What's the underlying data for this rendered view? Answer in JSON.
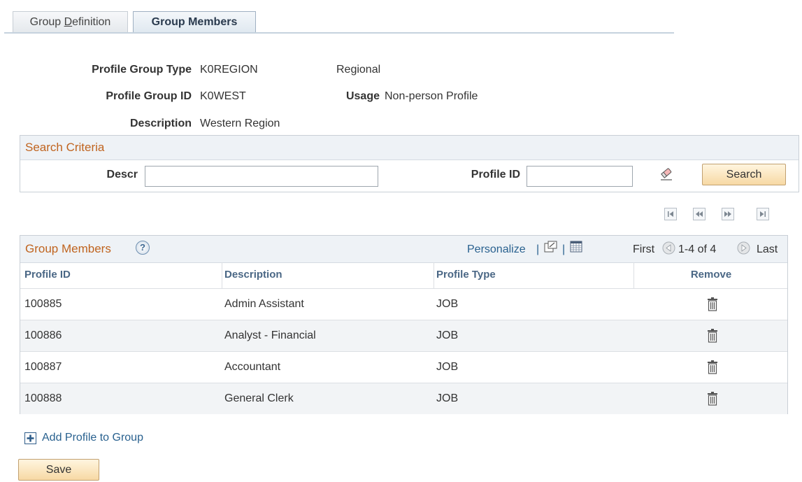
{
  "tabs": [
    {
      "label": "Group Definition",
      "active": false
    },
    {
      "label": "Group Members",
      "active": true
    }
  ],
  "header": {
    "profile_group_type_label": "Profile Group Type",
    "profile_group_type": "K0REGION",
    "profile_group_type_desc": "Regional",
    "profile_group_id_label": "Profile Group ID",
    "profile_group_id": "K0WEST",
    "usage_label": "Usage",
    "usage": "Non-person Profile",
    "description_label": "Description",
    "description": "Western Region"
  },
  "search": {
    "title": "Search Criteria",
    "descr_label": "Descr",
    "descr_value": "",
    "profile_id_label": "Profile ID",
    "profile_id_value": "",
    "clear_icon": "eraser-icon",
    "search_button": "Search"
  },
  "grid": {
    "title": "Group Members",
    "personalize": "Personalize",
    "separator": "|",
    "first": "First",
    "range": "1-4 of 4",
    "last": "Last",
    "columns": [
      "Profile ID",
      "Description",
      "Profile Type",
      "Remove"
    ],
    "rows": [
      {
        "profile_id": "100885",
        "description": "Admin Assistant",
        "profile_type": "JOB"
      },
      {
        "profile_id": "100886",
        "description": "Analyst - Financial",
        "profile_type": "JOB"
      },
      {
        "profile_id": "100887",
        "description": "Accountant",
        "profile_type": "JOB"
      },
      {
        "profile_id": "100888",
        "description": "General Clerk",
        "profile_type": "JOB"
      }
    ]
  },
  "add_profile_link": "Add Profile to Group",
  "save_button": "Save",
  "colors": {
    "section_title": "#c0641f",
    "link": "#29618f",
    "column_header": "#4a6785"
  }
}
